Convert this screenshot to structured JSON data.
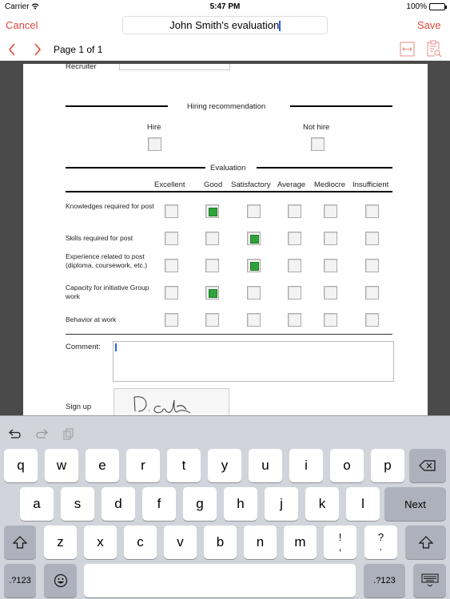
{
  "status_bar": {
    "carrier": "Carrier",
    "time": "5:47 PM",
    "battery": "100%"
  },
  "nav": {
    "cancel": "Cancel",
    "title": "John Smith's evaluation",
    "save": "Save"
  },
  "toolbar": {
    "page_label": "Page 1 of 1",
    "icons": [
      "chevron-left-icon",
      "chevron-right-icon",
      "fit-width-icon",
      "document-search-icon"
    ]
  },
  "form": {
    "recruiter_label": "Recruiter",
    "recruiter_value": "",
    "hiring_section": "Hiring recommendation",
    "hire_label": "Hire",
    "hire_checked": false,
    "not_hire_label": "Not hire",
    "not_hire_checked": false,
    "evaluation_section": "Evaluation",
    "columns": [
      "Excellent",
      "Good",
      "Satisfactory",
      "Average",
      "Mediocre",
      "Insufficient"
    ],
    "rows": [
      {
        "label": "Knowledges required for post",
        "selected": "Good"
      },
      {
        "label": "Skills required for post",
        "selected": "Satisfactory"
      },
      {
        "label": "Experience related to post (diploma, coursework, etc.)",
        "selected": "Satisfactory"
      },
      {
        "label": "Capacity for initiative Group work",
        "selected": "Good"
      },
      {
        "label": "Behavior at work",
        "selected": null
      }
    ],
    "comment_label": "Comment:",
    "comment_value": "",
    "sign_label": "Sign up",
    "signature_present": true
  },
  "keyboard": {
    "toolbar_icons": [
      "undo-icon",
      "redo-icon",
      "paste-icon"
    ],
    "row1": [
      "q",
      "w",
      "e",
      "r",
      "t",
      "y",
      "u",
      "i",
      "o",
      "p"
    ],
    "row2": [
      "a",
      "s",
      "d",
      "f",
      "g",
      "h",
      "j",
      "k",
      "l"
    ],
    "next": "Next",
    "row3": [
      "z",
      "x",
      "c",
      "v",
      "b",
      "n",
      "m"
    ],
    "punct1_top": "!",
    "punct1_bottom": ",",
    "punct2_top": "?",
    "punct2_bottom": ".",
    "num_left": ".?123",
    "num_right": ".?123",
    "space": ""
  },
  "colors": {
    "accent": "#e0473c",
    "checked": "#2fa33a",
    "caret": "#2b5fd9"
  }
}
